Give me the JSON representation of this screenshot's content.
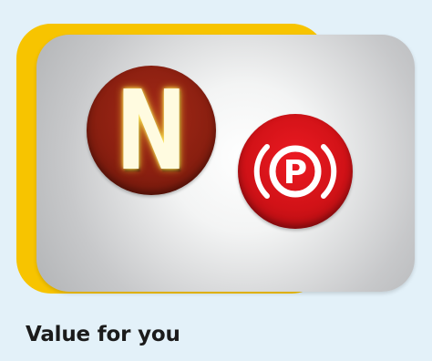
{
  "card": {
    "accent_color": "#f7c400",
    "background": "light-gray-gradient"
  },
  "badges": {
    "neutral": {
      "letter": "N",
      "icon": "neutral-gear-icon",
      "color": "#8a1f10",
      "letter_color": "#fffbe0"
    },
    "parking": {
      "letter": "P",
      "icon": "parking-brake-icon",
      "color": "#d11217",
      "symbol_color": "#ffffff"
    }
  },
  "caption": {
    "text": "Value for you"
  }
}
